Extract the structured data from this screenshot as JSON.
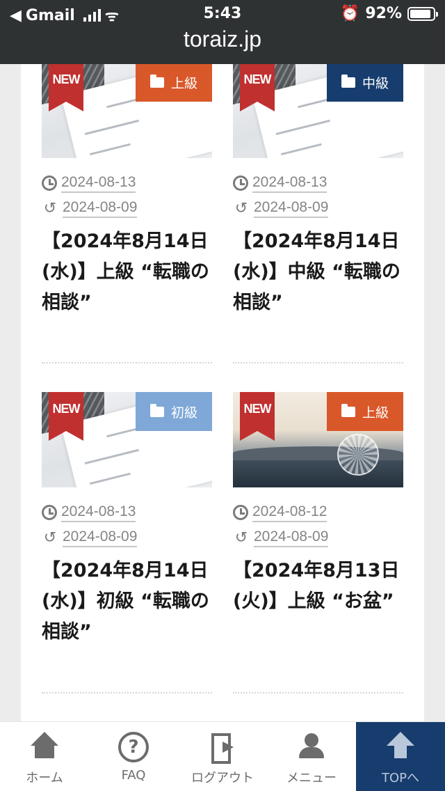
{
  "status_bar": {
    "back_app": "Gmail",
    "time": "5:43",
    "battery": "92%",
    "battery_level": 0.92
  },
  "url_bar": {
    "domain": "toraiz.jp"
  },
  "colors": {
    "cat_advanced": "#d9582a",
    "cat_intermediate": "#173d6e",
    "cat_beginner": "#7fa8d8",
    "new_ribbon": "#c0302f"
  },
  "posts": [
    {
      "badge": "NEW",
      "category": "上級",
      "published": "2024-08-13",
      "updated": "2024-08-09",
      "title": "【2024年8月14日(水)】上級 “転職の相談”"
    },
    {
      "badge": "NEW",
      "category": "中級",
      "published": "2024-08-13",
      "updated": "2024-08-09",
      "title": "【2024年8月14日(水)】中級 “転職の相談”"
    },
    {
      "badge": "NEW",
      "category": "初級",
      "published": "2024-08-13",
      "updated": "2024-08-09",
      "title": "【2024年8月14日(水)】初級 “転職の相談”"
    },
    {
      "badge": "NEW",
      "category": "上級",
      "published": "2024-08-12",
      "updated": "2024-08-09",
      "title": "【2024年8月13日(火)】上級 “お盆”"
    }
  ],
  "bottom_nav": {
    "home": "ホーム",
    "faq": "FAQ",
    "logout": "ログアウト",
    "menu": "メニュー",
    "top": "TOPへ"
  }
}
